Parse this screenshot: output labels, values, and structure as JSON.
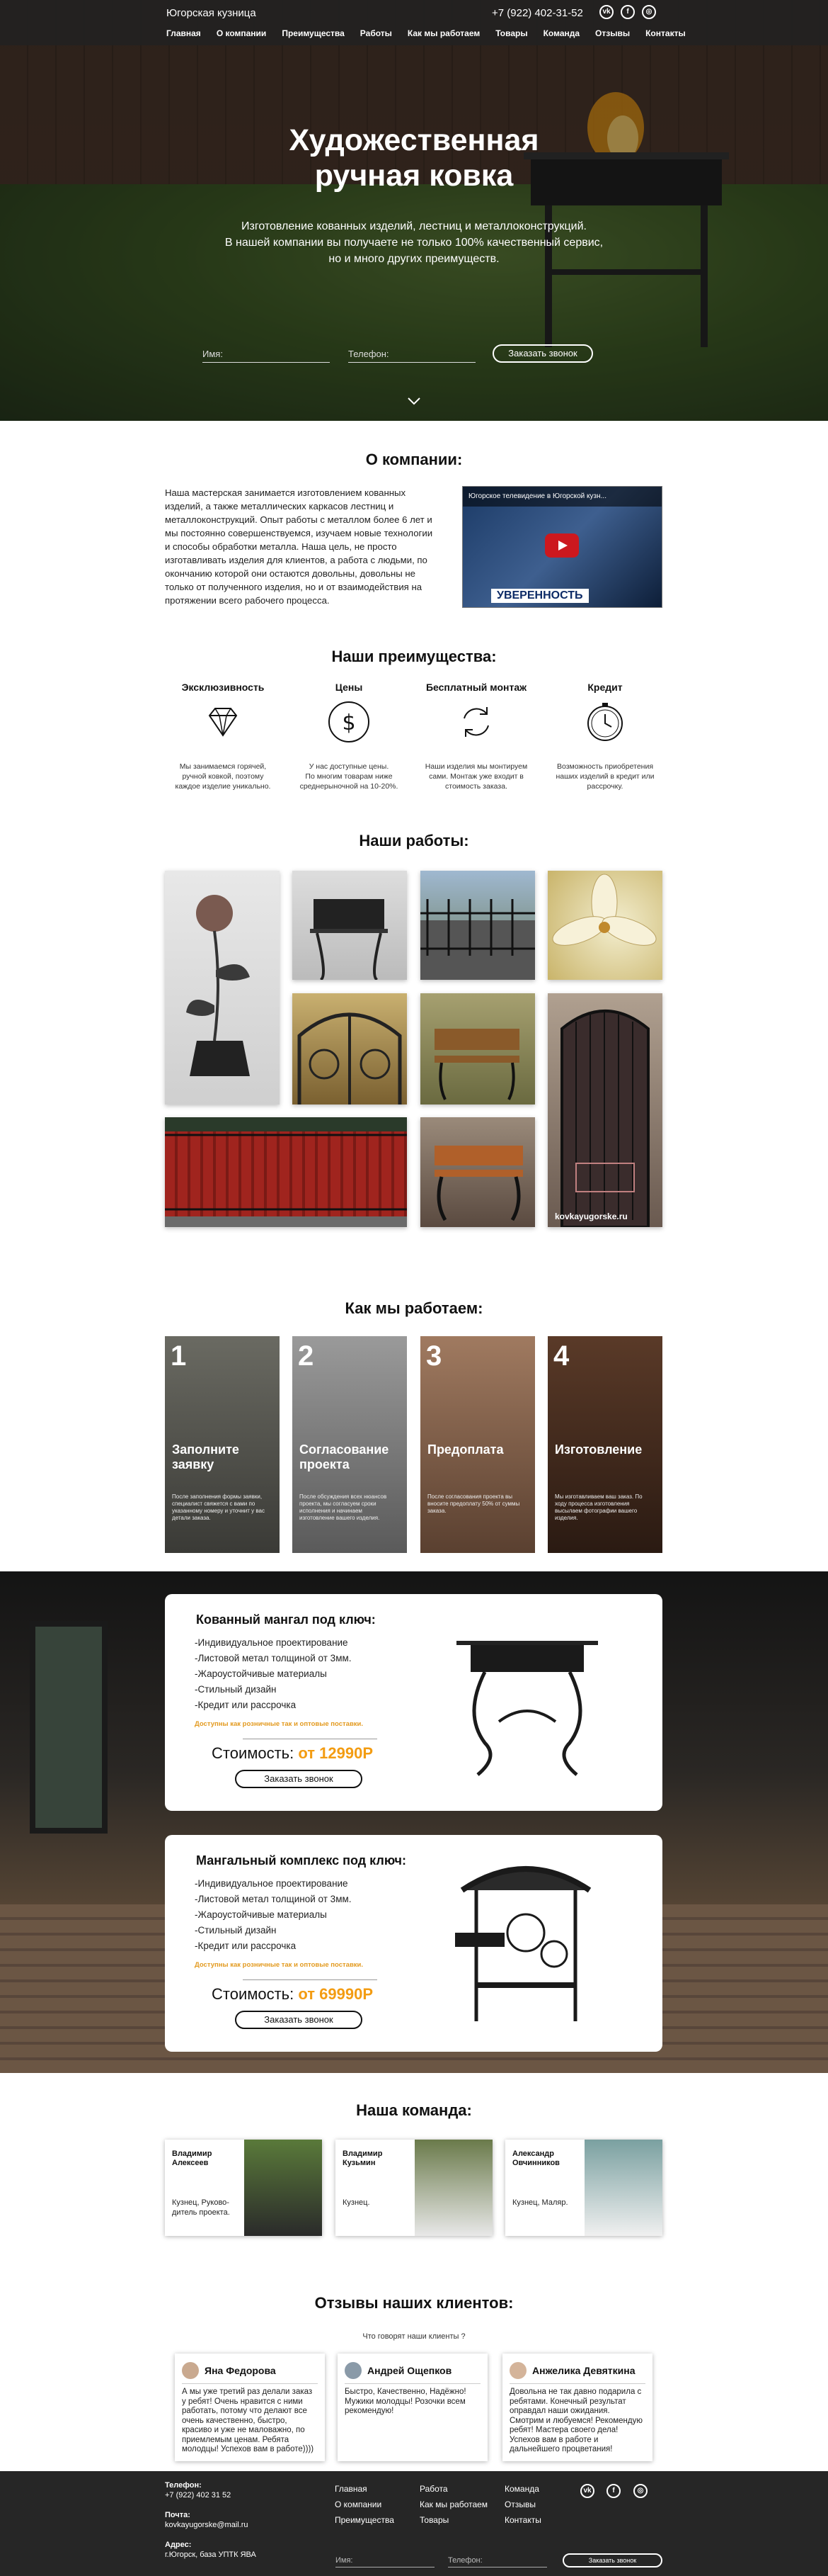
{
  "header": {
    "brand": "Югорская кузница",
    "phone": "+7 (922) 402-31-52",
    "social": [
      {
        "icon": "vk-icon",
        "text": "vk"
      },
      {
        "icon": "facebook-icon",
        "text": "f"
      },
      {
        "icon": "instagram-icon",
        "text": "◎"
      }
    ],
    "nav": [
      "Главная",
      "О компании",
      "Преимущества",
      "Работы",
      "Как мы работаем",
      "Товары",
      "Команда",
      "Отзывы",
      "Контакты"
    ]
  },
  "hero": {
    "title_line1": "Художественная",
    "title_line2": "ручная ковка",
    "sub_line1": "Изготовление кованных изделий, лестниц и металлоконструкций.",
    "sub_line2": "В нашей компании вы получаете не только 100% качественный сервис,",
    "sub_line3": "но и много других преимуществ.",
    "name_placeholder": "Имя:",
    "phone_placeholder": "Телефон:",
    "button": "Заказать звонок"
  },
  "about": {
    "title": "О компании:",
    "text": "Наша мастерская занимается изготовлением кованных изделий, а также металлических каркасов лестниц и металлоконструкций. Опыт работы с металлом более 6 лет и мы постоянно совершенствуемся, изучаем новые технологии и способы обработки металла. Наша цель, не просто изготавливать изделия для клиентов, а работа с людьми, по окончанию которой они остаются довольны, довольны не только от полученного изделия, но и от взаимодействия на протяжении всего рабочего процесса.",
    "video_title": "Югорское телевидение в Югорской кузн...",
    "video_banner": "УВЕРЕННОСТЬ"
  },
  "advantages": {
    "title": "Наши преимущества:",
    "items": [
      {
        "title": "Эксклюзивность",
        "icon": "diamond-icon",
        "desc_l1": "Мы занимаемся горячей,",
        "desc_l2": "ручной ковкой, поэтому",
        "desc_l3": "каждое изделие уникально."
      },
      {
        "title": "Цены",
        "icon": "dollar-icon",
        "desc_l1": "У нас доступные цены.",
        "desc_l2": "По многим товарам ниже",
        "desc_l3": "среднерыночной на 10-20%."
      },
      {
        "title": "Бесплатный монтаж",
        "icon": "refresh-icon",
        "desc_l1": "Наши изделия мы монтируем",
        "desc_l2": "сами. Монтаж уже входит в",
        "desc_l3": "стоимость заказа."
      },
      {
        "title": "Кредит",
        "icon": "clock-icon",
        "desc_l1": "Возможность приобретения",
        "desc_l2": "наших изделий в кредит или",
        "desc_l3": "рассрочку."
      }
    ]
  },
  "works": {
    "title": "Наши работы:",
    "watermark": "kovkayugorske.ru"
  },
  "how": {
    "title": "Как мы работаем:",
    "steps": [
      {
        "num": "1",
        "t1": "Заполните",
        "t2": "заявку",
        "desc": "После заполнения формы заявки, специалист свяжется с вами по указанному номеру и уточнит у вас детали заказа."
      },
      {
        "num": "2",
        "t1": "Согласование",
        "t2": "проекта",
        "desc": "После обсуждения всех нюансов проекта, мы согласуем сроки исполнения и начинаем изготовление вашего изделия."
      },
      {
        "num": "3",
        "t1": "Предоплата",
        "t2": "",
        "desc": "После согласования проекта вы вносите предоплату 50% от суммы заказа."
      },
      {
        "num": "4",
        "t1": "Изготовление",
        "t2": "",
        "desc": "Мы изготавливаем ваш заказ. По ходу процесса изготовления высылаем фотографии вашего изделия."
      }
    ]
  },
  "offers": [
    {
      "title": "Кованный мангал под ключ:",
      "features": [
        "-Индивидуальное проектирование",
        "-Листовой метал толщиной от 3мм.",
        "-Жароустойчивые материалы",
        "-Стильный дизайн",
        "-Кредит или рассрочка"
      ],
      "shipping": "Доступны как розничные так и оптовые поставки.",
      "price_label": "Стоимость:",
      "price": "от 12990Р",
      "button": "Заказать звонок"
    },
    {
      "title": "Мангальный комплекс под ключ:",
      "features": [
        "-Индивидуальное проектирование",
        "-Листовой метал толщиной от 3мм.",
        "-Жароустойчивые материалы",
        "-Стильный дизайн",
        "-Кредит или рассрочка"
      ],
      "shipping": "Доступны как розничные так и оптовые поставки.",
      "price_label": "Стоимость:",
      "price": "от 69990Р",
      "button": "Заказать звонок"
    }
  ],
  "team": {
    "title": "Наша команда:",
    "members": [
      {
        "n1": "Владимир",
        "n2": "Алексеев",
        "r1": "Кузнец, Руково-",
        "r2": "дитель проекта."
      },
      {
        "n1": "Владимир",
        "n2": "Кузьмин",
        "r1": "Кузнец.",
        "r2": ""
      },
      {
        "n1": "Александр",
        "n2": "Овчинников",
        "r1": "Кузнец, Маляр.",
        "r2": ""
      }
    ]
  },
  "reviews": {
    "title": "Отзывы наших клиентов:",
    "subtitle": "Что говорят наши клиенты ?",
    "items": [
      {
        "name": "Яна Федорова",
        "text": "А мы уже третий раз делали заказ у ребят! Очень нравится с ними работать, потому что делают все очень качественно, быстро, красиво и уже не маловажно, по приемлемым ценам. Ребята молодцы! Успехов вам в работе))))"
      },
      {
        "name": "Андрей Ощепков",
        "text": "Быстро, Качественно, Надёжно! Мужики молодцы! Розочки всем рекомендую!"
      },
      {
        "name": "Анжелика Девяткина",
        "text": "Довольна не так давно подарила с ребятами. Конечный результат оправдал наши ожидания. Смотрим и любуемся! Рекомендую ребят! Мастера своего дела! Успехов вам в работе и дальнейшего процветания!"
      }
    ]
  },
  "footer": {
    "phone_label": "Телефон:",
    "phone": "+7 (922) 402 31 52",
    "mail_label": "Почта:",
    "mail": "kovkayugorske@mail.ru",
    "addr_label": "Адрес:",
    "addr": "г.Югорск, база УПТК ЯВА",
    "menu_col1": [
      "Главная",
      "О компании",
      "Преимущества"
    ],
    "menu_col2": [
      "Работа",
      "Как мы работаем",
      "Товары"
    ],
    "menu_col3": [
      "Команда",
      "Отзывы",
      "Контакты"
    ],
    "name_placeholder": "Имя:",
    "phone_placeholder": "Телефон:",
    "button": "Заказать звонок"
  }
}
